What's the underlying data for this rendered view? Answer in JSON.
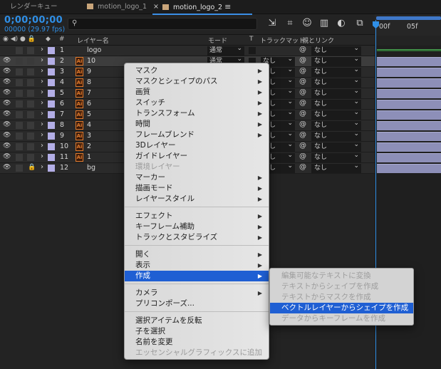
{
  "tabs": [
    {
      "label": "レンダーキュー"
    },
    {
      "label": "motion_logo_1"
    },
    {
      "label": "motion_logo_2",
      "close": "×",
      "menu": "≡"
    }
  ],
  "timecode": "0;00;00;00",
  "frame_rate": "00000 (29.97 fps)",
  "search": {
    "icon": "⚲",
    "placeholder": ""
  },
  "ruler": {
    "start": "00f",
    "mark": "05f"
  },
  "columns": {
    "label": "#",
    "layer_name": "レイヤー名",
    "mode": "モード",
    "t": "T",
    "trackmatte": "トラックマット",
    "parent": "親とリンク"
  },
  "layers": [
    {
      "num": "1",
      "name": "logo",
      "mode": "通常",
      "track": "",
      "parent": "なし",
      "ai": false
    },
    {
      "num": "2",
      "name": "10",
      "mode": "通常",
      "track": "なし",
      "parent": "なし",
      "ai": true
    },
    {
      "num": "3",
      "name": "9",
      "mode": "",
      "track": "なし",
      "parent": "なし",
      "ai": true
    },
    {
      "num": "4",
      "name": "8",
      "mode": "",
      "track": "なし",
      "parent": "なし",
      "ai": true
    },
    {
      "num": "5",
      "name": "7",
      "mode": "",
      "track": "なし",
      "parent": "なし",
      "ai": true
    },
    {
      "num": "6",
      "name": "6",
      "mode": "",
      "track": "なし",
      "parent": "なし",
      "ai": true
    },
    {
      "num": "7",
      "name": "5",
      "mode": "",
      "track": "なし",
      "parent": "なし",
      "ai": true
    },
    {
      "num": "8",
      "name": "4",
      "mode": "",
      "track": "なし",
      "parent": "なし",
      "ai": true
    },
    {
      "num": "9",
      "name": "3",
      "mode": "",
      "track": "なし",
      "parent": "なし",
      "ai": true
    },
    {
      "num": "10",
      "name": "2",
      "mode": "",
      "track": "なし",
      "parent": "なし",
      "ai": true
    },
    {
      "num": "11",
      "name": "1",
      "mode": "",
      "track": "なし",
      "parent": "なし",
      "ai": true
    },
    {
      "num": "12",
      "name": "bg",
      "mode": "",
      "track": "なし",
      "parent": "なし",
      "ai": false
    }
  ],
  "context_menu": [
    {
      "label": "マスク",
      "sub": true
    },
    {
      "label": "マスクとシェイプのパス",
      "sub": true
    },
    {
      "label": "画質",
      "sub": true
    },
    {
      "label": "スイッチ",
      "sub": true
    },
    {
      "label": "トランスフォーム",
      "sub": true
    },
    {
      "label": "時間",
      "sub": true
    },
    {
      "label": "フレームブレンド",
      "sub": true
    },
    {
      "label": "3Dレイヤー"
    },
    {
      "label": "ガイドレイヤー"
    },
    {
      "label": "環境レイヤー",
      "disabled": true
    },
    {
      "label": "マーカー",
      "sub": true
    },
    {
      "label": "描画モード",
      "sub": true
    },
    {
      "label": "レイヤースタイル",
      "sub": true
    },
    {
      "label": "エフェクト",
      "sub": true
    },
    {
      "label": "キーフレーム補助",
      "sub": true
    },
    {
      "label": "トラックとスタビライズ",
      "sub": true
    },
    {
      "label": "開く",
      "sub": true
    },
    {
      "label": "表示",
      "sub": true
    },
    {
      "label": "作成",
      "sub": true,
      "highlight": true
    },
    {
      "label": "カメラ",
      "sub": true
    },
    {
      "label": "プリコンポーズ..."
    },
    {
      "label": "選択アイテムを反転"
    },
    {
      "label": "子を選択"
    },
    {
      "label": "名前を変更"
    },
    {
      "label": "エッセンシャルグラフィックスに追加",
      "disabled": true
    }
  ],
  "submenu": [
    {
      "label": "編集可能なテキストに変換"
    },
    {
      "label": "テキストからシェイプを作成"
    },
    {
      "label": "テキストからマスクを作成"
    },
    {
      "label": "ベクトルレイヤーからシェイプを作成",
      "highlight": true
    },
    {
      "label": "データからキーフレームを作成"
    }
  ],
  "colors": {
    "accent": "#2f8fe6",
    "highlight": "#1f5fd3",
    "layer_label": "#b3aee6",
    "ai_orange": "#e07a2c"
  }
}
